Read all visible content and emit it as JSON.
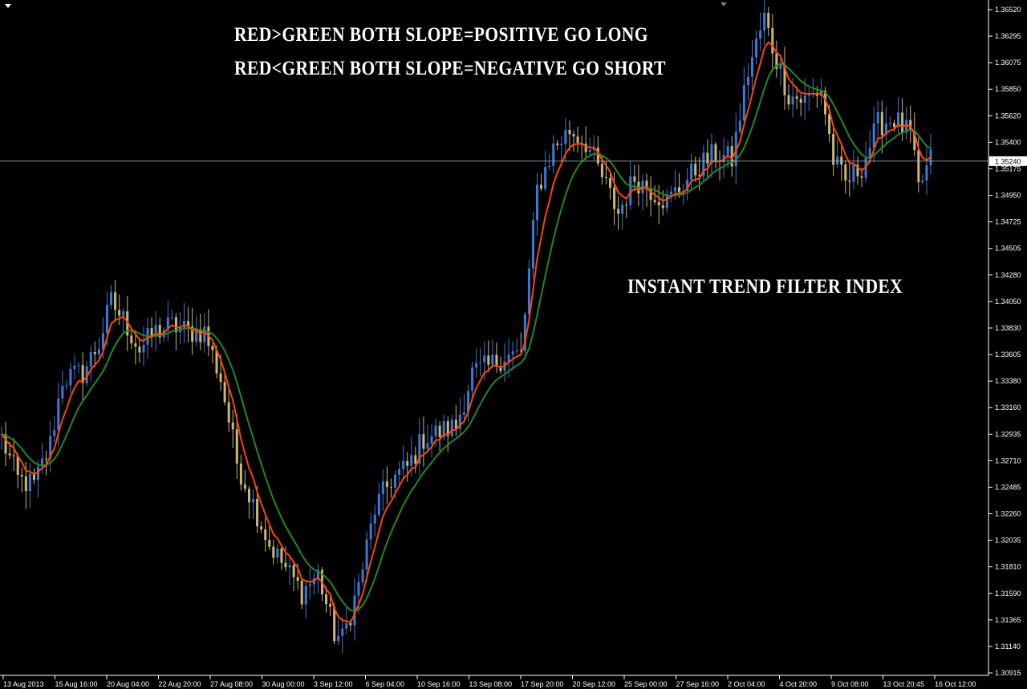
{
  "chart_data": {
    "type": "candlestick",
    "instrument_line": {
      "price": "1.35240"
    },
    "annotations": [
      "RED>GREEN  BOTH SLOPE=POSITIVE GO LONG",
      "RED<GREEN  BOTH SLOPE=NEGATIVE GO SHORT",
      "INSTANT TREND FILTER INDEX"
    ],
    "y_ticks": [
      "1.36520",
      "1.36295",
      "1.36075",
      "1.35850",
      "1.35620",
      "1.35400",
      "1.35175",
      "1.34950",
      "1.34725",
      "1.34505",
      "1.34280",
      "1.34050",
      "1.33830",
      "1.33605",
      "1.33380",
      "1.33160",
      "1.32935",
      "1.32710",
      "1.32485",
      "1.32260",
      "1.32035",
      "1.31810",
      "1.31590",
      "1.31365",
      "1.31140",
      "1.30915"
    ],
    "ylim": [
      1.30915,
      1.3652
    ],
    "x_ticks": [
      "13 Aug 2013",
      "15 Aug 16:00",
      "20 Aug 04:00",
      "22 Aug 20:00",
      "27 Aug 08:00",
      "30 Aug 00:00",
      "3 Sep 12:00",
      "6 Sep 04:00",
      "10 Sep 16:00",
      "13 Sep 08:00",
      "17 Sep 20:00",
      "20 Sep 12:00",
      "25 Sep 00:00",
      "27 Sep 16:00",
      "2 Oct 04:00",
      "4 Oct 20:00",
      "9 Oct 08:00",
      "13 Oct 20:45",
      "16 Oct 12:00"
    ],
    "close_anchors": [
      [
        0,
        1.329
      ],
      [
        4,
        1.3255
      ],
      [
        8,
        1.325
      ],
      [
        12,
        1.3285
      ],
      [
        15,
        1.334
      ],
      [
        20,
        1.3345
      ],
      [
        24,
        1.337
      ],
      [
        27,
        1.3405
      ],
      [
        30,
        1.339
      ],
      [
        34,
        1.3365
      ],
      [
        38,
        1.338
      ],
      [
        42,
        1.3385
      ],
      [
        46,
        1.338
      ],
      [
        50,
        1.338
      ],
      [
        54,
        1.334
      ],
      [
        58,
        1.327
      ],
      [
        62,
        1.3235
      ],
      [
        66,
        1.32
      ],
      [
        70,
        1.318
      ],
      [
        74,
        1.316
      ],
      [
        78,
        1.3175
      ],
      [
        82,
        1.3125
      ],
      [
        84,
        1.312
      ],
      [
        88,
        1.3165
      ],
      [
        92,
        1.323
      ],
      [
        96,
        1.3255
      ],
      [
        100,
        1.3265
      ],
      [
        104,
        1.329
      ],
      [
        108,
        1.3295
      ],
      [
        112,
        1.33
      ],
      [
        116,
        1.3345
      ],
      [
        120,
        1.335
      ],
      [
        124,
        1.336
      ],
      [
        128,
        1.336
      ],
      [
        132,
        1.35
      ],
      [
        136,
        1.3535
      ],
      [
        140,
        1.355
      ],
      [
        144,
        1.354
      ],
      [
        148,
        1.351
      ],
      [
        152,
        1.348
      ],
      [
        156,
        1.351
      ],
      [
        160,
        1.35
      ],
      [
        164,
        1.349
      ],
      [
        168,
        1.3505
      ],
      [
        172,
        1.352
      ],
      [
        176,
        1.353
      ],
      [
        180,
        1.3525
      ],
      [
        184,
        1.36
      ],
      [
        188,
        1.3645
      ],
      [
        190,
        1.362
      ],
      [
        194,
        1.358
      ],
      [
        198,
        1.3575
      ],
      [
        202,
        1.3585
      ],
      [
        205,
        1.3525
      ],
      [
        208,
        1.3505
      ],
      [
        212,
        1.352
      ],
      [
        216,
        1.3555
      ],
      [
        220,
        1.356
      ],
      [
        224,
        1.3545
      ],
      [
        226,
        1.35
      ],
      [
        229,
        1.3525
      ]
    ],
    "series": [
      {
        "name": "",
        "color": "#ff4500"
      },
      {
        "name": "",
        "color": "#1f8a1f"
      }
    ],
    "candle_colors": {
      "bull": "#3a7ad8",
      "bear": "#c8b878"
    },
    "grid": false
  }
}
